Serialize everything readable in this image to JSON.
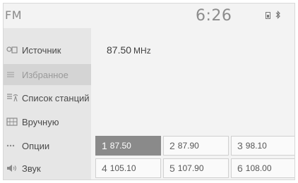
{
  "header": {
    "title": "FM",
    "clock": "6:26",
    "battery_icon": "battery-icon",
    "bluetooth_icon": "bluetooth-icon"
  },
  "sidebar": {
    "items": [
      {
        "label": "Источник",
        "icon": "source-icon"
      },
      {
        "label": "Избранное",
        "icon": "favorites-icon",
        "active": true
      },
      {
        "label": "Список станций",
        "icon": "station-list-icon"
      },
      {
        "label": "Вручную",
        "icon": "manual-tune-icon"
      },
      {
        "label": "Опции",
        "icon": "more-options-icon"
      },
      {
        "label": "Звук",
        "icon": "speaker-icon"
      }
    ]
  },
  "current": {
    "frequency": "87.50",
    "unit": "MHz"
  },
  "presets": [
    {
      "num": "1",
      "freq": "87.50",
      "selected": true
    },
    {
      "num": "2",
      "freq": "87.90"
    },
    {
      "num": "3",
      "freq": "98.10"
    },
    {
      "num": "4",
      "freq": "105.10"
    },
    {
      "num": "5",
      "freq": "107.90"
    },
    {
      "num": "6",
      "freq": "108.00"
    }
  ],
  "colors": {
    "selected_preset": "#8a8a8a",
    "sidebar_bg": "#e6e6e6",
    "active_item_bg": "#d4d4d4"
  }
}
